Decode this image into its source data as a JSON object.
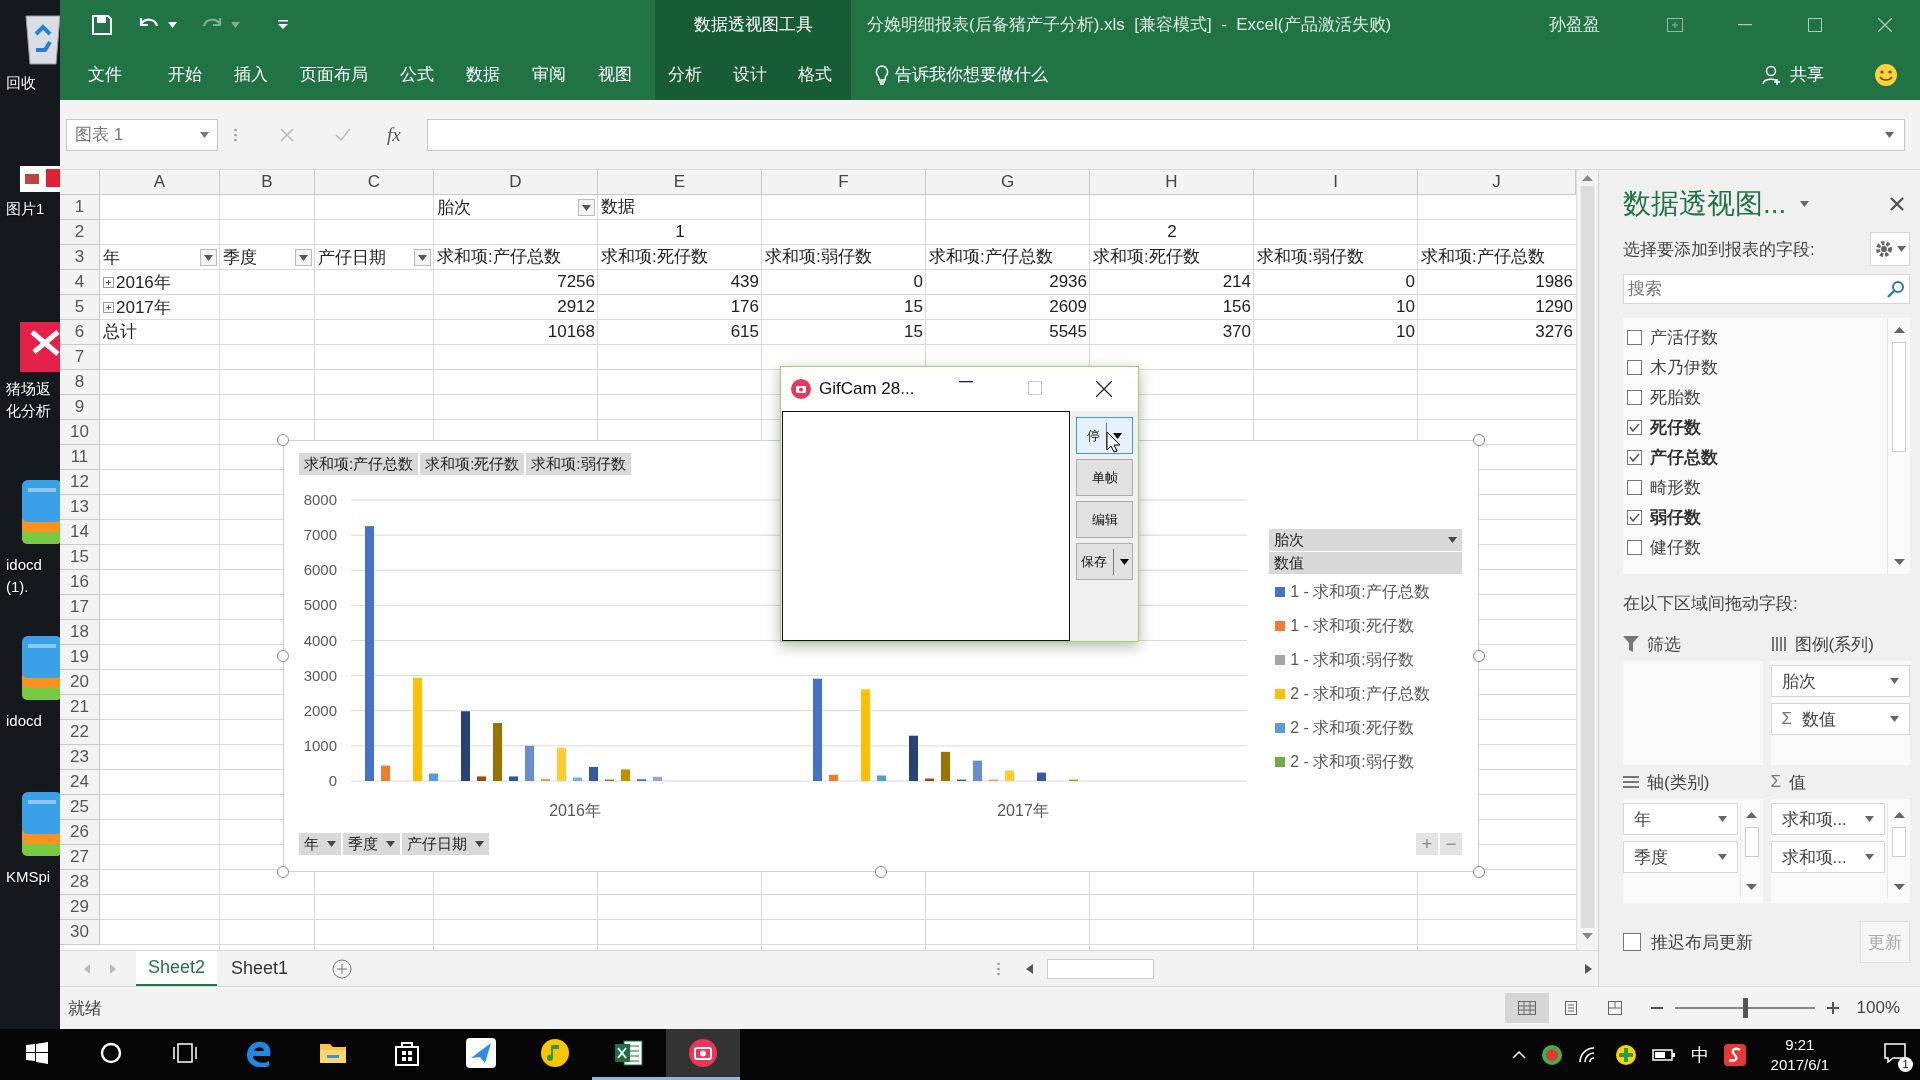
{
  "desktop": {
    "icons": [
      {
        "kind": "recycle",
        "lines": [
          "回收"
        ]
      },
      {
        "kind": "image",
        "lines": [
          "图片1"
        ]
      },
      {
        "kind": "app",
        "lines": [
          "猪场返",
          "化分析"
        ]
      },
      {
        "kind": "archive",
        "lines": [
          "idocd",
          "(1)."
        ]
      },
      {
        "kind": "archive",
        "lines": [
          "idocd"
        ]
      },
      {
        "kind": "archive",
        "lines": [
          "KMSpi"
        ]
      }
    ]
  },
  "window": {
    "context_group": "数据透视图工具",
    "title": "分娩明细报表(后备猪产子分析).xls  [兼容模式]  -  Excel(产品激活失败)",
    "user": "孙盈盈"
  },
  "ribbon_tabs": [
    {
      "label": "文件",
      "contextual": false
    },
    {
      "label": "开始",
      "contextual": false
    },
    {
      "label": "插入",
      "contextual": false
    },
    {
      "label": "页面布局",
      "contextual": false
    },
    {
      "label": "公式",
      "contextual": false
    },
    {
      "label": "数据",
      "contextual": false
    },
    {
      "label": "审阅",
      "contextual": false
    },
    {
      "label": "视图",
      "contextual": false
    },
    {
      "label": "分析",
      "contextual": true
    },
    {
      "label": "设计",
      "contextual": true
    },
    {
      "label": "格式",
      "contextual": true
    }
  ],
  "tell_me": "告诉我你想要做什么",
  "share": "共享",
  "formula_bar": {
    "name_box": "图表 1",
    "function_label": "fx"
  },
  "sheet": {
    "columns": [
      "A",
      "B",
      "C",
      "D",
      "E",
      "F",
      "G",
      "H",
      "I",
      "J"
    ],
    "rows": [
      "1",
      "2",
      "3",
      "4",
      "5",
      "6",
      "7",
      "8",
      "9",
      "10",
      "11",
      "12",
      "13",
      "14",
      "15",
      "16",
      "17",
      "18",
      "19",
      "20",
      "21",
      "22",
      "23",
      "24",
      "25",
      "26",
      "27",
      "28",
      "29",
      "30"
    ],
    "pivot_rows": [
      [
        null,
        null,
        null,
        {
          "kind": "field",
          "text": "胎次",
          "dropdown": true
        },
        {
          "kind": "field",
          "text": "数据",
          "dropdown": false
        },
        null,
        null,
        null,
        null,
        null
      ],
      [
        null,
        null,
        null,
        {
          "kind": "group",
          "text": "1"
        },
        null,
        null,
        {
          "kind": "group",
          "text": "2"
        },
        null,
        null,
        null
      ],
      [
        {
          "kind": "field",
          "text": "年",
          "dropdown": true
        },
        {
          "kind": "field",
          "text": "季度",
          "dropdown": true
        },
        {
          "kind": "field",
          "text": "产仔日期",
          "dropdown": true
        },
        {
          "kind": "field",
          "text": "求和项:产仔总数",
          "dropdown": false
        },
        {
          "kind": "field",
          "text": "求和项:死仔数",
          "dropdown": false
        },
        {
          "kind": "field",
          "text": "求和项:弱仔数",
          "dropdown": false
        },
        {
          "kind": "field",
          "text": "求和项:产仔总数",
          "dropdown": false
        },
        {
          "kind": "field",
          "text": "求和项:死仔数",
          "dropdown": false
        },
        {
          "kind": "field",
          "text": "求和项:弱仔数",
          "dropdown": false
        },
        {
          "kind": "field",
          "text": "求和项:产仔总数",
          "dropdown": false
        }
      ],
      [
        {
          "kind": "expander",
          "text": "2016年",
          "expanded": false
        },
        null,
        null,
        {
          "kind": "number",
          "text": "7256"
        },
        {
          "kind": "number",
          "text": "439"
        },
        {
          "kind": "number",
          "text": "0"
        },
        {
          "kind": "number",
          "text": "2936"
        },
        {
          "kind": "number",
          "text": "214"
        },
        {
          "kind": "number",
          "text": "0"
        },
        {
          "kind": "number",
          "text": "1986"
        }
      ],
      [
        {
          "kind": "expander",
          "text": "2017年",
          "expanded": false
        },
        null,
        null,
        {
          "kind": "number",
          "text": "2912"
        },
        {
          "kind": "number",
          "text": "176"
        },
        {
          "kind": "number",
          "text": "15"
        },
        {
          "kind": "number",
          "text": "2609"
        },
        {
          "kind": "number",
          "text": "156"
        },
        {
          "kind": "number",
          "text": "10"
        },
        {
          "kind": "number",
          "text": "1290"
        }
      ],
      [
        {
          "kind": "label",
          "text": "总计"
        },
        null,
        null,
        {
          "kind": "number",
          "text": "10168"
        },
        {
          "kind": "number",
          "text": "615"
        },
        {
          "kind": "number",
          "text": "15"
        },
        {
          "kind": "number",
          "text": "5545"
        },
        {
          "kind": "number",
          "text": "370"
        },
        {
          "kind": "number",
          "text": "10"
        },
        {
          "kind": "number",
          "text": "3276"
        }
      ]
    ]
  },
  "chart": {
    "field_buttons": [
      "求和项:产仔总数",
      "求和项:死仔数",
      "求和项:弱仔数"
    ],
    "legend_field": "胎次",
    "legend_header": "数值",
    "axis_fields": [
      "年",
      "季度",
      "产仔日期"
    ],
    "zoom_buttons": [
      "+",
      "−"
    ],
    "chart_data": {
      "type": "bar",
      "grid": true,
      "categories": [
        "2016年",
        "2017年"
      ],
      "ylim": [
        0,
        8000
      ],
      "yticks": [
        0,
        1000,
        2000,
        3000,
        4000,
        5000,
        6000,
        7000,
        8000
      ],
      "series": [
        {
          "name": "1 - 求和项:产仔总数",
          "color": "#4472c4",
          "values": [
            7256,
            2912
          ]
        },
        {
          "name": "1 - 求和项:死仔数",
          "color": "#ed7d31",
          "values": [
            439,
            176
          ]
        },
        {
          "name": "1 - 求和项:弱仔数",
          "color": "#a5a5a5",
          "values": [
            0,
            null
          ]
        },
        {
          "name": "2 - 求和项:产仔总数",
          "color": "#ffc000",
          "values": [
            2936,
            2609
          ]
        },
        {
          "name": "2 - 求和项:死仔数",
          "color": "#5b9bd5",
          "values": [
            214,
            156
          ]
        },
        {
          "name": "2 - 求和项:弱仔数",
          "color": "#70ad47",
          "values": [
            0,
            null
          ]
        },
        {
          "color": "#264478",
          "values": [
            1986,
            1290
          ]
        },
        {
          "color": "#9e480e",
          "values": [
            130,
            70
          ]
        },
        {
          "color": "#997300",
          "values": [
            1650,
            830
          ]
        },
        {
          "color": "#255e91",
          "values": [
            130,
            40
          ]
        },
        {
          "color": "#698ed0",
          "values": [
            1000,
            580
          ]
        },
        {
          "color": "#f1975a",
          "values": [
            60,
            40
          ]
        },
        {
          "color": "#ffcd33",
          "values": [
            950,
            300
          ]
        },
        {
          "color": "#7cafdd",
          "values": [
            100,
            0
          ]
        },
        {
          "color": "#335aa1",
          "values": [
            400,
            240
          ]
        },
        {
          "color": "#c55a11",
          "values": [
            40,
            0
          ]
        },
        {
          "color": "#bf9000",
          "values": [
            330,
            40
          ]
        },
        {
          "color": "#3a75b1",
          "values": [
            50,
            0
          ]
        },
        {
          "color": "#8faadc",
          "values": [
            120,
            0
          ]
        }
      ]
    }
  },
  "gifcam": {
    "title": "GifCam 28...",
    "buttons": [
      {
        "label": "停",
        "dropdown": true,
        "focused": true
      },
      {
        "label": "单帧",
        "dropdown": false,
        "focused": false
      },
      {
        "label": "编辑",
        "dropdown": false,
        "focused": false
      },
      {
        "label": "保存",
        "dropdown": true,
        "focused": false
      }
    ]
  },
  "pivot_pane": {
    "title": "数据透视图...",
    "prompt": "选择要添加到报表的字段:",
    "search": {
      "placeholder": "搜索"
    },
    "fields": [
      {
        "label": "产活仔数",
        "checked": false
      },
      {
        "label": "木乃伊数",
        "checked": false
      },
      {
        "label": "死胎数",
        "checked": false
      },
      {
        "label": "死仔数",
        "checked": true
      },
      {
        "label": "产仔总数",
        "checked": true
      },
      {
        "label": "畸形数",
        "checked": false
      },
      {
        "label": "弱仔数",
        "checked": true
      },
      {
        "label": "健仔数",
        "checked": false
      }
    ],
    "drag_prompt": "在以下区域间拖动字段:",
    "areas": [
      {
        "kind": "filter",
        "title": "筛选"
      },
      {
        "kind": "legend",
        "title": "图例(系列)",
        "items": [
          {
            "label": "胎次"
          },
          {
            "prefix": "Σ",
            "label": "数值"
          }
        ]
      },
      {
        "kind": "axis",
        "title": "轴(类别)",
        "items": [
          {
            "label": "年"
          },
          {
            "label": "季度"
          }
        ]
      },
      {
        "kind": "values",
        "symbol": "Σ",
        "title": "值",
        "items": [
          {
            "label": "求和项..."
          },
          {
            "label": "求和项..."
          }
        ]
      }
    ],
    "defer": {
      "label": "推迟布局更新",
      "checked": false
    },
    "update_button": {
      "label": "更新",
      "disabled": true
    }
  },
  "sheet_tabs": [
    {
      "label": "Sheet2",
      "selected": true
    },
    {
      "label": "Sheet1",
      "selected": false
    }
  ],
  "status_bar": {
    "text": "就绪",
    "views": [
      {
        "kind": "normal",
        "selected": true
      },
      {
        "kind": "page-layout",
        "selected": false
      },
      {
        "kind": "page-break",
        "selected": false
      }
    ],
    "zoom_slider": {
      "level": 0.5
    },
    "zoom": "100%"
  },
  "taskbar": {
    "apps": [
      {
        "kind": "start",
        "running": false,
        "selected": false
      },
      {
        "kind": "search",
        "running": false,
        "selected": false
      },
      {
        "kind": "task-view",
        "running": false,
        "selected": false
      },
      {
        "kind": "edge",
        "running": false,
        "selected": false
      },
      {
        "kind": "folder",
        "running": false,
        "selected": false
      },
      {
        "kind": "store",
        "running": false,
        "selected": false
      },
      {
        "kind": "bird",
        "running": false,
        "selected": false
      },
      {
        "kind": "music",
        "running": false,
        "selected": false
      },
      {
        "kind": "excel",
        "running": true,
        "selected": false
      },
      {
        "kind": "camera",
        "running": true,
        "selected": true
      }
    ],
    "ime": "中",
    "time": "9:21",
    "date": "2017/6/1",
    "notifications": "1"
  }
}
